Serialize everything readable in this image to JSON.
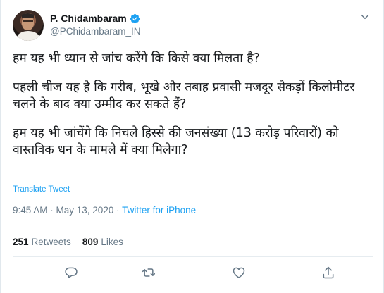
{
  "author": {
    "display_name": "P. Chidambaram",
    "handle": "@PChidambaram_IN",
    "verified": true
  },
  "tweet": {
    "paragraphs": [
      "हम यह भी ध्यान से जांच करेंगे कि किसे क्या मिलता है?",
      "पहली चीज यह है कि गरीब, भूखे और तबाह प्रवासी मजदूर सैकड़ों किलोमीटर चलने के बाद क्या उम्मीद कर सकते हैं?",
      "हम यह भी जांचेंगे कि निचले हिस्से की जनसंख्या (13 करोड़ परिवारों)  को वास्तविक धन के मामले में क्या मिलेगा?"
    ],
    "translate_label": "Translate Tweet",
    "time": "9:45 AM",
    "separator": " · ",
    "date": "May 13, 2020",
    "source": "Twitter for iPhone"
  },
  "stats": {
    "retweets_count": "251",
    "retweets_label": "Retweets",
    "likes_count": "809",
    "likes_label": "Likes"
  },
  "icons": {
    "verified": "verified-badge-icon",
    "more": "chevron-down-icon",
    "reply": "reply-icon",
    "retweet": "retweet-icon",
    "like": "heart-icon",
    "share": "share-icon"
  },
  "colors": {
    "accent": "#1da1f2",
    "secondary_text": "#657786",
    "primary_text": "#14171a",
    "divider": "#e6ecf0"
  }
}
